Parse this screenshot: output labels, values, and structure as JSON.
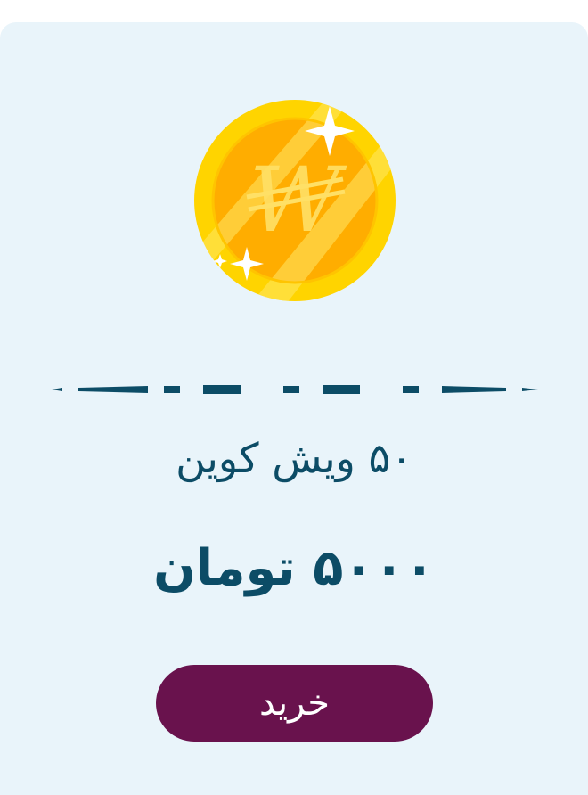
{
  "product": {
    "icon": "wish-coin-icon",
    "title": "۵۰ ویش کوین",
    "price": "۵۰۰۰ تومان",
    "buy_label": "خرید"
  },
  "colors": {
    "card_background": "#e9f4fa",
    "text": "#0c4c66",
    "button": "#69124d",
    "button_text": "#ffffff",
    "coin_outer": "#ffd400",
    "coin_inner": "#ffad00"
  }
}
